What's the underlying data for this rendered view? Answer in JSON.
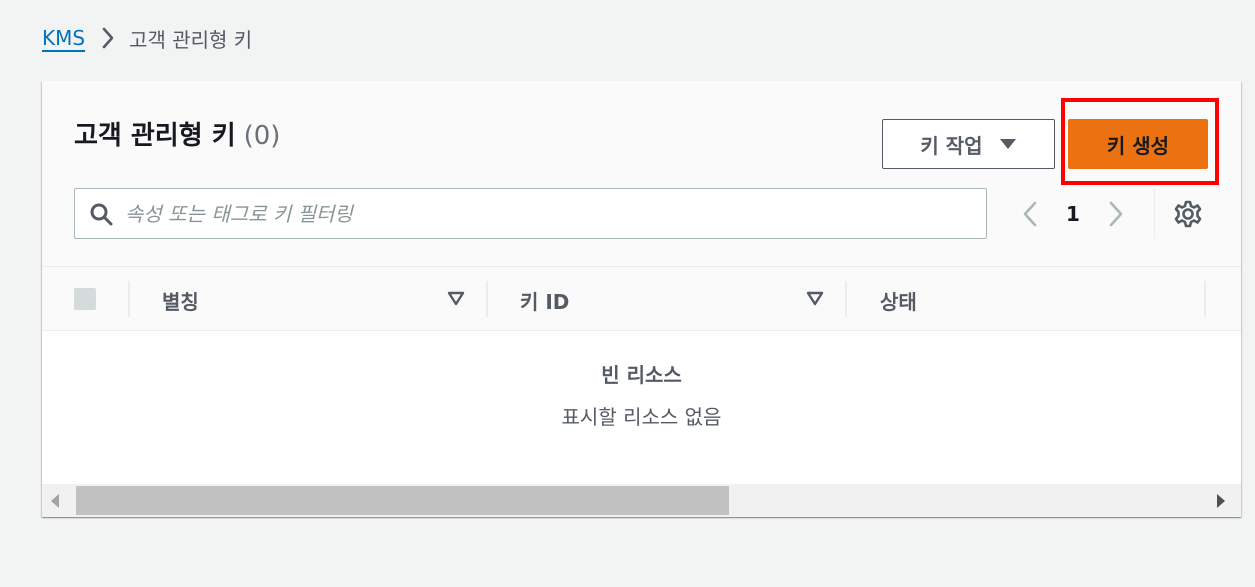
{
  "breadcrumb": {
    "root_label": "KMS",
    "current_label": "고객 관리형 키"
  },
  "panel": {
    "title": "고객 관리형 키",
    "count": "(0)",
    "actions_button_label": "키 작업",
    "create_button_label": "키 생성",
    "search_placeholder": "속성 또는 태그로 키 필터링",
    "page_number": "1"
  },
  "table": {
    "columns": [
      {
        "label": "별칭"
      },
      {
        "label": "키 ID"
      },
      {
        "label": "상태"
      }
    ],
    "empty_title": "빈 리소스",
    "empty_subtitle": "표시할 리소스 없음"
  },
  "colors": {
    "link": "#0073bb",
    "primary_button": "#ec7211",
    "highlight": "#ff0000"
  },
  "icons": [
    "chevron-right-icon",
    "caret-down-icon",
    "search-icon",
    "chevron-left-icon",
    "gear-icon",
    "sort-caret-icon"
  ]
}
